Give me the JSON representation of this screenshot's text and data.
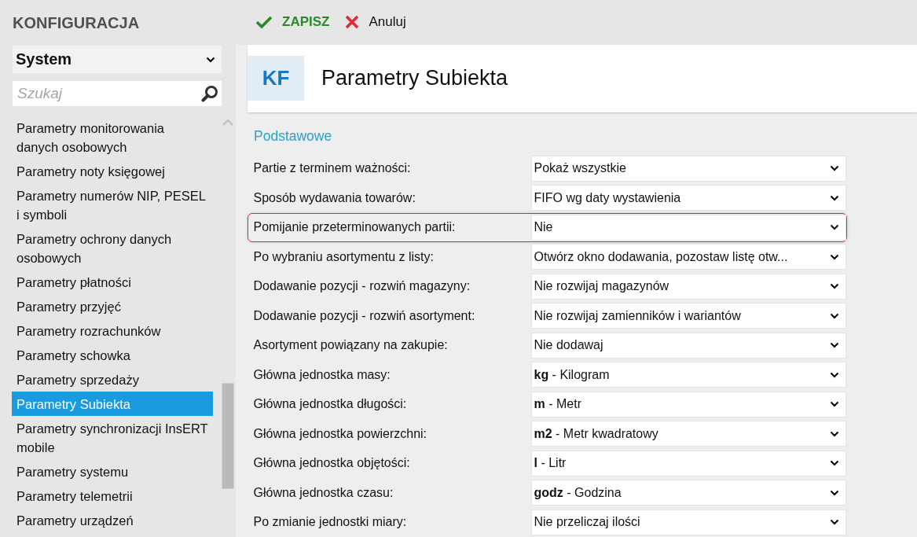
{
  "sidebar": {
    "title": "KONFIGURACJA",
    "category": "System",
    "search": {
      "placeholder": "Szukaj"
    },
    "items": [
      {
        "label": "Parametry monitorowania danych osobowych",
        "selected": false
      },
      {
        "label": "Parametry noty księgowej",
        "selected": false
      },
      {
        "label": "Parametry numerów NIP, PESEL i symboli",
        "selected": false
      },
      {
        "label": "Parametry ochrony danych osobowych",
        "selected": false
      },
      {
        "label": "Parametry płatności",
        "selected": false
      },
      {
        "label": "Parametry przyjęć",
        "selected": false
      },
      {
        "label": "Parametry rozrachunków",
        "selected": false
      },
      {
        "label": "Parametry schowka",
        "selected": false
      },
      {
        "label": "Parametry sprzedaży",
        "selected": false
      },
      {
        "label": "Parametry Subiekta",
        "selected": true
      },
      {
        "label": "Parametry synchronizacji InsERT mobile",
        "selected": false
      },
      {
        "label": "Parametry systemu",
        "selected": false
      },
      {
        "label": "Parametry telemetrii",
        "selected": false
      },
      {
        "label": "Parametry urządzeń",
        "selected": false
      }
    ]
  },
  "toolbar": [
    {
      "kind": "save",
      "label": "ZAPISZ"
    },
    {
      "kind": "cancel",
      "label": "Anuluj"
    }
  ],
  "header": {
    "badge": "KF",
    "title": "Parametry Subiekta"
  },
  "section": "Podstawowe",
  "rows": [
    {
      "label": "Partie z terminem ważności:",
      "value": "Pokaż wszystkie",
      "highlighted": false
    },
    {
      "label": "Sposób wydawania towarów:",
      "value": "FIFO wg daty wystawienia",
      "highlighted": false
    },
    {
      "label": "Pomijanie przeterminowanych partii:",
      "value": "Nie",
      "highlighted": true
    },
    {
      "label": "Po wybraniu asortymentu z listy:",
      "value": "Otwórz okno dodawania, pozostaw listę otw...",
      "highlighted": false
    },
    {
      "label": "Dodawanie pozycji - rozwiń magazyny:",
      "value": "Nie rozwijaj magazynów",
      "highlighted": false
    },
    {
      "label": "Dodawanie pozycji - rozwiń asortyment:",
      "value": "Nie rozwijaj zamienników i wariantów",
      "highlighted": false
    },
    {
      "label": "Asortyment powiązany na zakupie:",
      "value": "Nie dodawaj",
      "highlighted": false
    },
    {
      "label": "Główna jednostka masy:",
      "value": "**kg** - Kilogram",
      "highlighted": false
    },
    {
      "label": "Główna jednostka długości:",
      "value": "**m** - Metr",
      "highlighted": false
    },
    {
      "label": "Główna jednostka powierzchni:",
      "value": "**m2** - Metr kwadratowy",
      "highlighted": false
    },
    {
      "label": "Główna jednostka objętości:",
      "value": "**l** - Litr",
      "highlighted": false
    },
    {
      "label": "Główna jednostka czasu:",
      "value": "**godz** - Godzina",
      "highlighted": false
    },
    {
      "label": "Po zmianie jednostki miary:",
      "value": "Nie przeliczaj ilości",
      "highlighted": false
    }
  ]
}
